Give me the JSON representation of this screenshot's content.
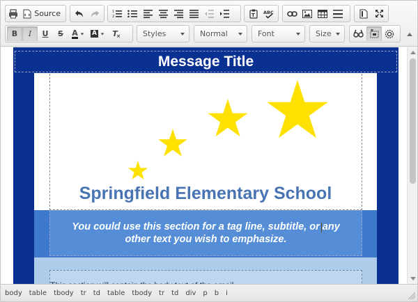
{
  "toolbar": {
    "source_label": "Source",
    "spell_label": "ABC",
    "styles_combo": "Styles",
    "format_combo": "Normal",
    "font_combo": "Font",
    "size_combo": "Size",
    "text_color_glyph": "A",
    "bg_color_glyph": "A",
    "bold_glyph": "B",
    "italic_glyph": "I",
    "underline_glyph": "U",
    "strike_glyph": "S",
    "remove_format_glyph": "T",
    "icons": [
      "print-icon",
      "source-icon",
      "undo-icon",
      "redo-icon",
      "numbered-list-icon",
      "bulleted-list-icon",
      "align-left-icon",
      "align-center-icon",
      "align-right-icon",
      "justify-icon",
      "outdent-icon",
      "indent-icon",
      "paste-text-icon",
      "spellcheck-icon",
      "link-icon",
      "image-icon",
      "table-icon",
      "horizontal-rule-icon",
      "preview-icon",
      "maximize-icon",
      "find-replace-icon",
      "show-blocks-icon",
      "settings-icon"
    ]
  },
  "document": {
    "message_title": "Message Title",
    "school_name": "Springfield Elementary School",
    "tagline": "You could use this section for a tag line, subtitle, or any other text you wish to emphasize.",
    "body_text": "This section will contain the body text of the email."
  },
  "path": [
    "body",
    "table",
    "tbody",
    "tr",
    "td",
    "table",
    "tbody",
    "tr",
    "td",
    "div",
    "p",
    "b",
    "i"
  ],
  "colors": {
    "navy": "#0a3192",
    "school_blue": "#4874b4",
    "tagline_blue": "#558ed6",
    "light_blue": "#bfd6ef",
    "star_yellow": "#ffe100"
  }
}
